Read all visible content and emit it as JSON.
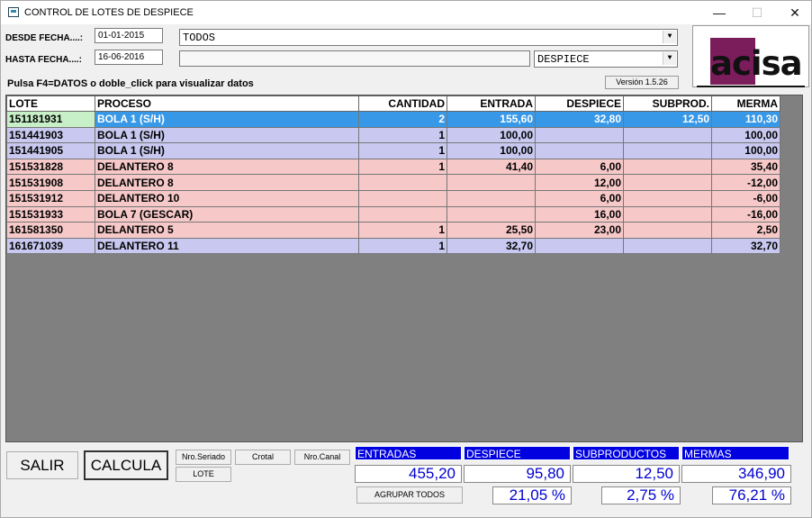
{
  "window": {
    "title": "CONTROL DE LOTES DE DESPIECE",
    "min_glyph": "—",
    "max_glyph": "☐",
    "close_glyph": "✕"
  },
  "filters": {
    "desde_label": "DESDE FECHA....:",
    "desde_value": "01-01-2015",
    "hasta_label": "HASTA FECHA....:",
    "hasta_value": "16-06-2016",
    "combo_todos": "TODOS",
    "combo_despiece": "DESPIECE",
    "combo_empty": ""
  },
  "logo": {
    "text_a": "ac",
    "text_b": "isa"
  },
  "version": "Versión 1.5.26",
  "hint": "Pulsa F4=DATOS o doble_click para visualizar datos",
  "grid": {
    "headers": {
      "lote": "LOTE",
      "proceso": "PROCESO",
      "cantidad": "CANTIDAD",
      "entrada": "ENTRADA",
      "despiece": "DESPIECE",
      "subprod": "SUBPROD.",
      "merma": "MERMA"
    },
    "rows": [
      {
        "lote": "151181931",
        "proceso": "BOLA 1 (S/H)",
        "cantidad": "2",
        "entrada": "155,60",
        "despiece": "32,80",
        "subprod": "12,50",
        "merma": "110,30",
        "style": "sel"
      },
      {
        "lote": "151441903",
        "proceso": "BOLA 1 (S/H)",
        "cantidad": "1",
        "entrada": "100,00",
        "despiece": "",
        "subprod": "",
        "merma": "100,00",
        "style": "blue"
      },
      {
        "lote": "151441905",
        "proceso": "BOLA 1 (S/H)",
        "cantidad": "1",
        "entrada": "100,00",
        "despiece": "",
        "subprod": "",
        "merma": "100,00",
        "style": "blue"
      },
      {
        "lote": "151531828",
        "proceso": "DELANTERO  8",
        "cantidad": "1",
        "entrada": "41,40",
        "despiece": "6,00",
        "subprod": "",
        "merma": "35,40",
        "style": "pink"
      },
      {
        "lote": "151531908",
        "proceso": "DELANTERO  8",
        "cantidad": "",
        "entrada": "",
        "despiece": "12,00",
        "subprod": "",
        "merma": "-12,00",
        "style": "pink"
      },
      {
        "lote": "151531912",
        "proceso": "DELANTERO 10",
        "cantidad": "",
        "entrada": "",
        "despiece": "6,00",
        "subprod": "",
        "merma": "-6,00",
        "style": "pink"
      },
      {
        "lote": "151531933",
        "proceso": "BOLA 7 (GESCAR)",
        "cantidad": "",
        "entrada": "",
        "despiece": "16,00",
        "subprod": "",
        "merma": "-16,00",
        "style": "pink"
      },
      {
        "lote": "161581350",
        "proceso": "DELANTERO  5",
        "cantidad": "1",
        "entrada": "25,50",
        "despiece": "23,00",
        "subprod": "",
        "merma": "2,50",
        "style": "pink"
      },
      {
        "lote": "161671039",
        "proceso": "DELANTERO 11",
        "cantidad": "1",
        "entrada": "32,70",
        "despiece": "",
        "subprod": "",
        "merma": "32,70",
        "style": "blue"
      }
    ]
  },
  "buttons": {
    "salir": "SALIR",
    "calcula": "CALCULA",
    "nro_seriado": "Nro.Seriado",
    "crotal": "Crotal",
    "nro_canal": "Nro.Canal",
    "lote": "LOTE",
    "agrupar": "AGRUPAR TODOS"
  },
  "totals": {
    "entradas_label": "ENTRADAS",
    "despiece_label": "DESPIECE",
    "subproductos_label": "SUBPRODUCTOS",
    "mermas_label": "MERMAS",
    "entradas": "455,20",
    "despiece": "95,80",
    "subproductos": "12,50",
    "mermas": "346,90",
    "despiece_pct": "21,05 %",
    "subproductos_pct": "2,75 %",
    "mermas_pct": "76,21 %"
  },
  "colors": {
    "row_blue": "#c8c8f0",
    "row_pink": "#f6c8c8",
    "row_selected": "#3898e8",
    "header_blue": "#0000e0",
    "total_text": "#0000d0",
    "grid_bg": "#808080",
    "logo_purple": "#7b1c5b"
  }
}
